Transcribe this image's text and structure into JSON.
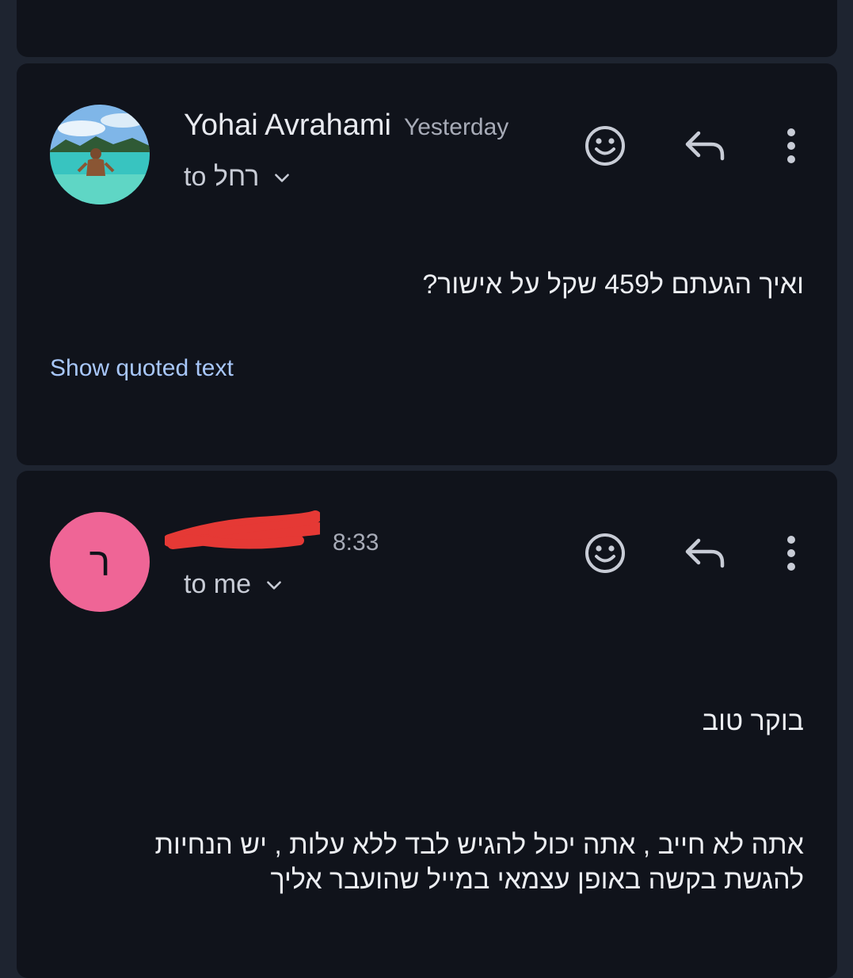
{
  "messages": [
    {
      "sender_name": "Yohai Avrahami",
      "time": "Yesterday",
      "recipient": "to רחל",
      "body_lines": [
        "ואיך הגעתם ל459 שקל על אישור?"
      ],
      "show_quoted_text": "Show quoted text",
      "avatar": {
        "type": "photo",
        "description_icon": "profile-photo-beach"
      }
    },
    {
      "sender_name": "",
      "time": "8:33",
      "recipient": "to me",
      "avatar": {
        "type": "letter",
        "letter": "ר",
        "color": "#ef6596"
      },
      "body_lines": [
        "בוקר טוב",
        "אתה לא חייב , אתה יכול להגיש לבד ללא עלות , יש הנחיות",
        "להגשת בקשה באופן עצמאי במייל שהועבר אליך"
      ]
    }
  ],
  "icons": {
    "react": "emoji-smile-icon",
    "reply": "reply-icon",
    "more": "more-vert-icon",
    "expand": "chevron-down-icon"
  },
  "colors": {
    "background": "#1e2430",
    "card": "#10131b",
    "link": "#a8c7fa",
    "avatar_letter_bg": "#ef6596",
    "redaction": "#e53935"
  }
}
